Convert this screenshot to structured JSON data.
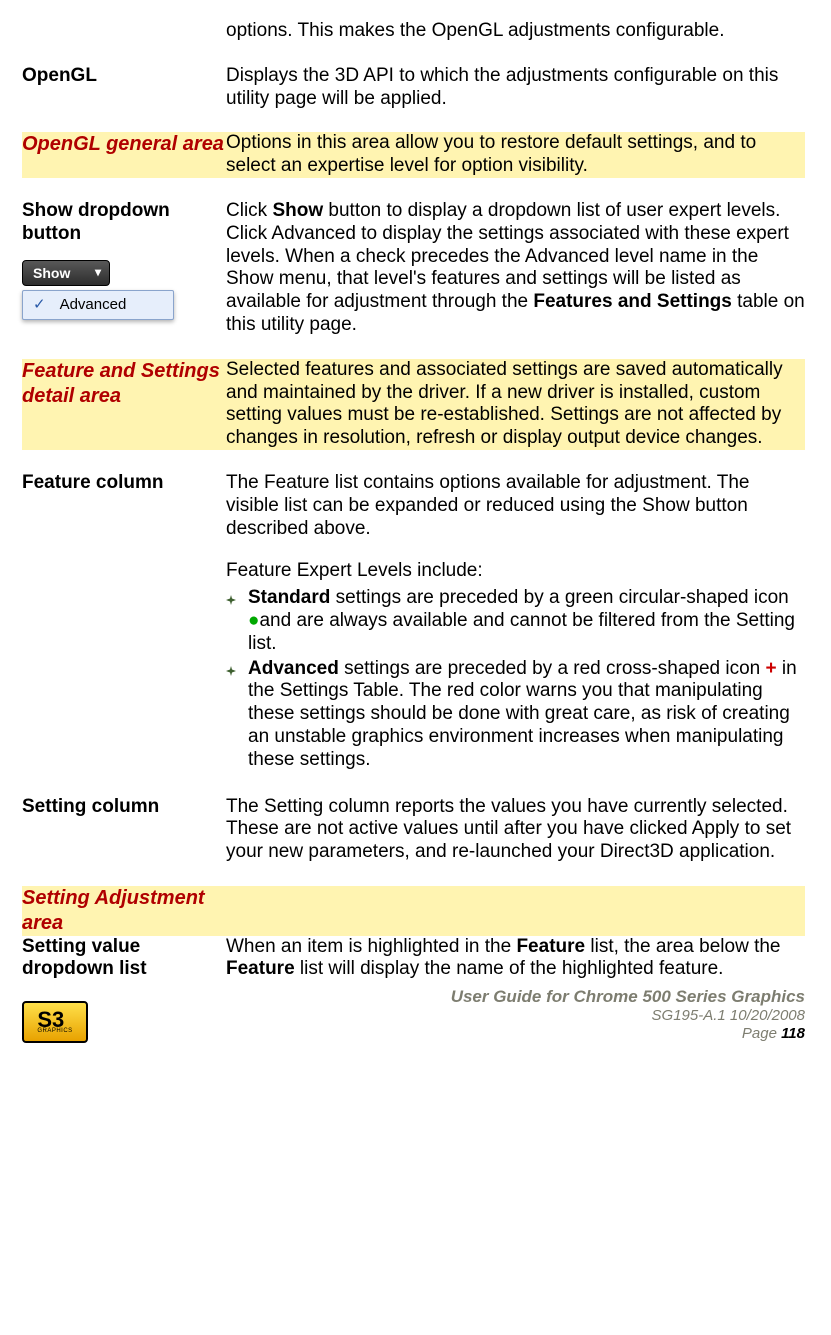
{
  "rows": {
    "intro": "options. This makes the OpenGL adjustments configurable.",
    "opengl_label": "OpenGL",
    "opengl_text": "Displays the 3D API to which the adjustments configurable on this utility page will be applied.",
    "general_area_label": "OpenGL general area",
    "general_area_text": "Options in this area allow you to restore default settings, and to select an expertise level for option visibility.",
    "showbtn_label": "Show dropdown button",
    "showbtn_button_text": "Show",
    "showbtn_menu_item": "Advanced",
    "showbtn_text_pre": "Click ",
    "showbtn_text_bold1": "Show",
    "showbtn_text_mid": " button to display a dropdown list of user expert levels. Click Advanced to display the settings associated with these expert levels. When a check precedes the Advanced level name in the Show menu, that level's features and settings will be listed as available for adjustment through the ",
    "showbtn_text_bold2": "Features and Settings",
    "showbtn_text_post": " table on this utility page.",
    "detail_area_label": "Feature and Settings detail area",
    "detail_area_text": "Selected features and associated settings are saved automatically and maintained by the driver. If a new driver is installed, custom setting values must be re-established. Settings are not affected by changes in resolution, refresh or display output device changes.",
    "featurecol_label": "Feature column",
    "featurecol_p1": "The Feature list contains options available for adjustment. The visible list can be expanded or reduced using the Show button described above.",
    "featurecol_p2": "Feature Expert Levels include:",
    "featurecol_b1_bold": "Standard",
    "featurecol_b1_pre": " settings are preceded by a green circular-shaped icon ",
    "featurecol_b1_post": "and are always available and cannot be filtered from the Setting list.",
    "featurecol_b2_bold": "Advanced",
    "featurecol_b2_pre": " settings are preceded by a red cross-shaped icon ",
    "featurecol_b2_post": " in the Settings Table. The red color warns you that manipulating these settings should be done with great care, as risk of creating an unstable graphics environment increases when manipulating these settings.",
    "settingcol_label": "Setting column",
    "settingcol_text": "The Setting column reports the values you have currently selected. These are not active values until after you have clicked Apply to set your new parameters, and re-launched your Direct3D application.",
    "adjust_area_label": "Setting Adjustment area",
    "dropdown_label": "Setting value dropdown list",
    "dropdown_text_pre": "When an item is highlighted in the ",
    "dropdown_text_bold1": "Feature",
    "dropdown_text_mid": " list, the area below the ",
    "dropdown_text_bold2": "Feature",
    "dropdown_text_post": " list will display the name of the highlighted feature."
  },
  "footer": {
    "title": "User Guide for Chrome 500 Series Graphics",
    "meta": "SG195-A.1   10/20/2008",
    "page_label": "Page ",
    "page_num": "118",
    "logo_main": "S3",
    "logo_sub": "GRAPHICS"
  },
  "icons": {
    "green_dot": "●",
    "red_plus": "+"
  }
}
